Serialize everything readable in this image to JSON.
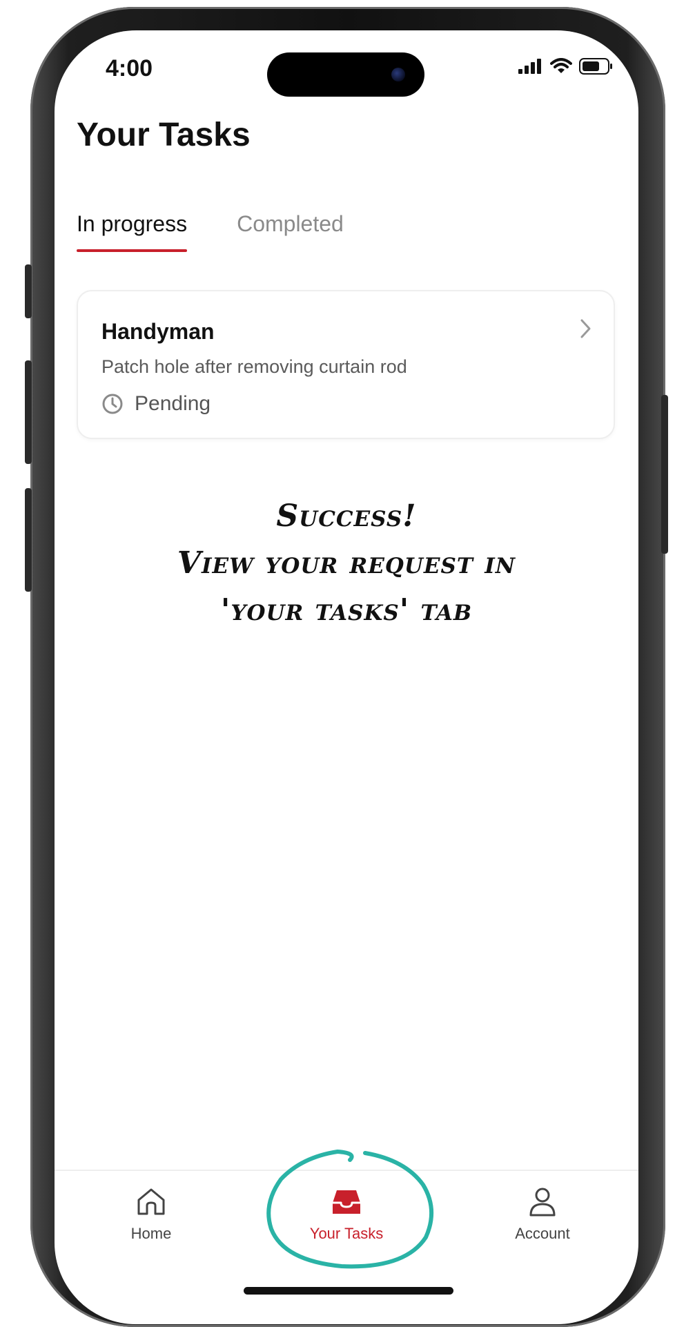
{
  "status_bar": {
    "time": "4:00"
  },
  "header": {
    "title": "Your Tasks"
  },
  "tabs": [
    {
      "label": "In progress",
      "active": true
    },
    {
      "label": "Completed",
      "active": false
    }
  ],
  "tasks": [
    {
      "title": "Handyman",
      "description": "Patch hole after removing curtain rod",
      "status": "Pending",
      "status_icon": "clock-icon"
    }
  ],
  "annotation": {
    "line1": "Success!",
    "line2": "View your request in",
    "line3": "'your tasks' tab",
    "circle_color": "#2ab3a6"
  },
  "tab_bar": {
    "items": [
      {
        "label": "Home",
        "icon": "home-icon",
        "active": false
      },
      {
        "label": "Your Tasks",
        "icon": "inbox-icon",
        "active": true
      },
      {
        "label": "Account",
        "icon": "user-icon",
        "active": false
      }
    ]
  },
  "colors": {
    "accent": "#c8202b",
    "annotation": "#2ab3a6",
    "text": "#111111",
    "muted": "#8a8a8a"
  }
}
